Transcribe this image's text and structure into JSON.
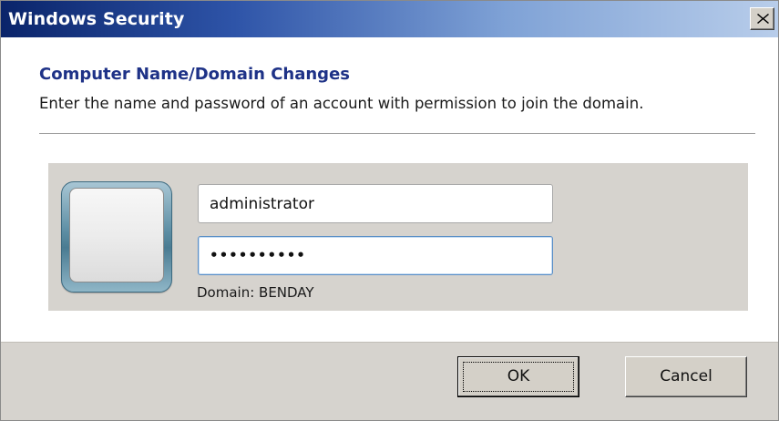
{
  "window": {
    "title": "Windows Security",
    "close_label": "X"
  },
  "header": {
    "heading": "Computer Name/Domain Changes",
    "instruction": "Enter the name and password of an account with permission to join the domain."
  },
  "credentials": {
    "username_value": "administrator",
    "password_value": "••••••••••",
    "domain_text": "Domain: BENDAY",
    "user_tile_icon": "user-picture-icon"
  },
  "buttons": {
    "ok_label": "OK",
    "cancel_label": "Cancel"
  },
  "colors": {
    "heading": "#1e3287",
    "panel": "#d6d3ce"
  }
}
